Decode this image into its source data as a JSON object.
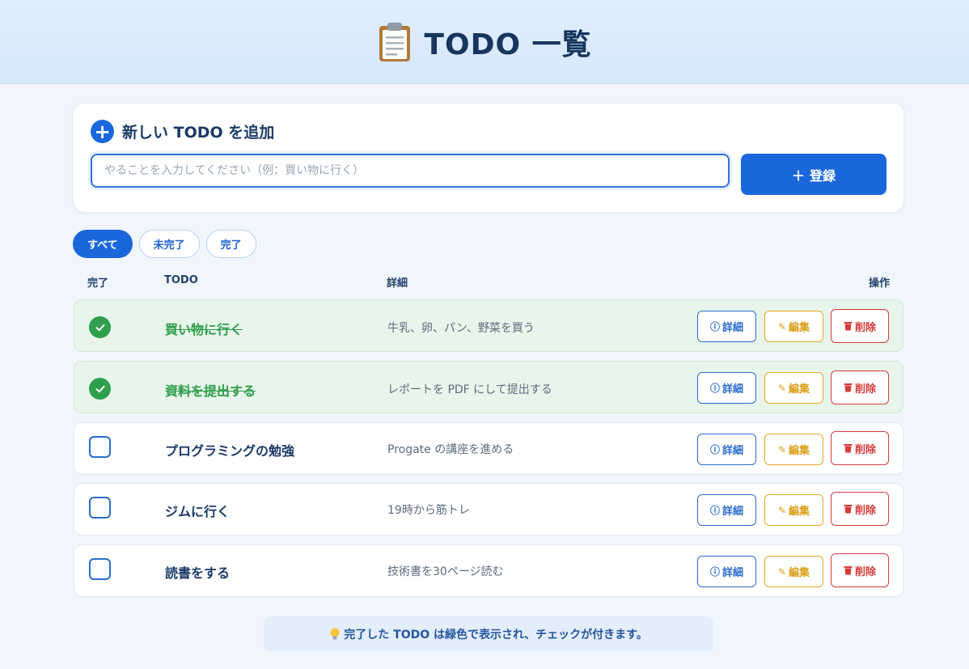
{
  "header": {
    "title": "TODO 一覧",
    "icon": "clipboard-icon"
  },
  "add_form": {
    "heading": "新しい TODO を追加",
    "input_placeholder": "やることを入力してください（例：買い物に行く）",
    "input_value": "",
    "register_label": "登録"
  },
  "filters": [
    {
      "label": "すべて",
      "active": true
    },
    {
      "label": "未完了",
      "active": false
    },
    {
      "label": "完了",
      "active": false
    }
  ],
  "columns": {
    "done": "完了",
    "todo": "TODO",
    "detail": "詳細",
    "actions": "操作"
  },
  "todos": [
    {
      "title": "買い物に行く",
      "detail": "牛乳、卵、パン、野菜を買う",
      "done": true
    },
    {
      "title": "資料を提出する",
      "detail": "レポートを PDF にして提出する",
      "done": true
    },
    {
      "title": "プログラミングの勉強",
      "detail": "Progate の講座を進める",
      "done": false
    },
    {
      "title": "ジムに行く",
      "detail": "19時から筋トレ",
      "done": false
    },
    {
      "title": "読書をする",
      "detail": "技術書を30ページ読む",
      "done": false
    }
  ],
  "row_actions": {
    "detail": "詳細",
    "edit": "編集",
    "delete": "削除"
  },
  "hint": {
    "icon": "lightbulb-icon",
    "text": "完了した TODO は緑色で表示され、チェックが付きます。"
  },
  "colors": {
    "primary": "#1a67dc",
    "done_green": "#2f9e4d",
    "edit_amber": "#e5a91e",
    "delete_red": "#d63b3b"
  }
}
